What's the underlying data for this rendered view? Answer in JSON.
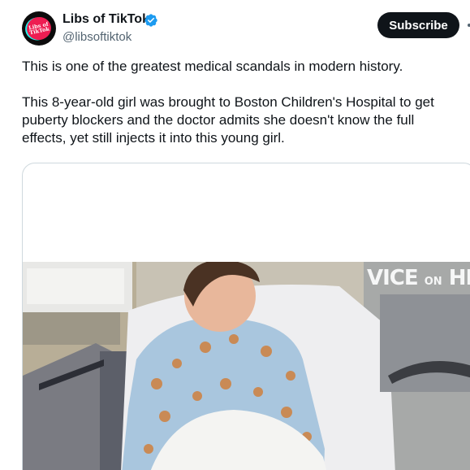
{
  "tweet": {
    "author": {
      "display_name": "Libs of TikTok",
      "handle": "@libsoftiktok",
      "verified": true,
      "avatar_icon": "libs-of-tiktok-logo",
      "avatar_text": "Libs of TikTok"
    },
    "subscribe_label": "Subscribe",
    "more_icon": "more-horizontal-icon",
    "paragraphs": [
      "This is one of the greatest medical scandals in modern history.",
      "This 8-year-old girl was brought to Boston Children's Hospital to get puberty blockers and the doctor admits she doesn't know the full effects, yet still injects it into this young girl."
    ],
    "media": {
      "type": "video",
      "watermark": {
        "prefix": "VICE",
        "connector": "ON",
        "network": "HBO"
      }
    }
  },
  "colors": {
    "text": "#0f1419",
    "muted": "#536471",
    "verified": "#1d9bf0",
    "button_bg": "#0f1419",
    "border": "#cfd9de"
  }
}
